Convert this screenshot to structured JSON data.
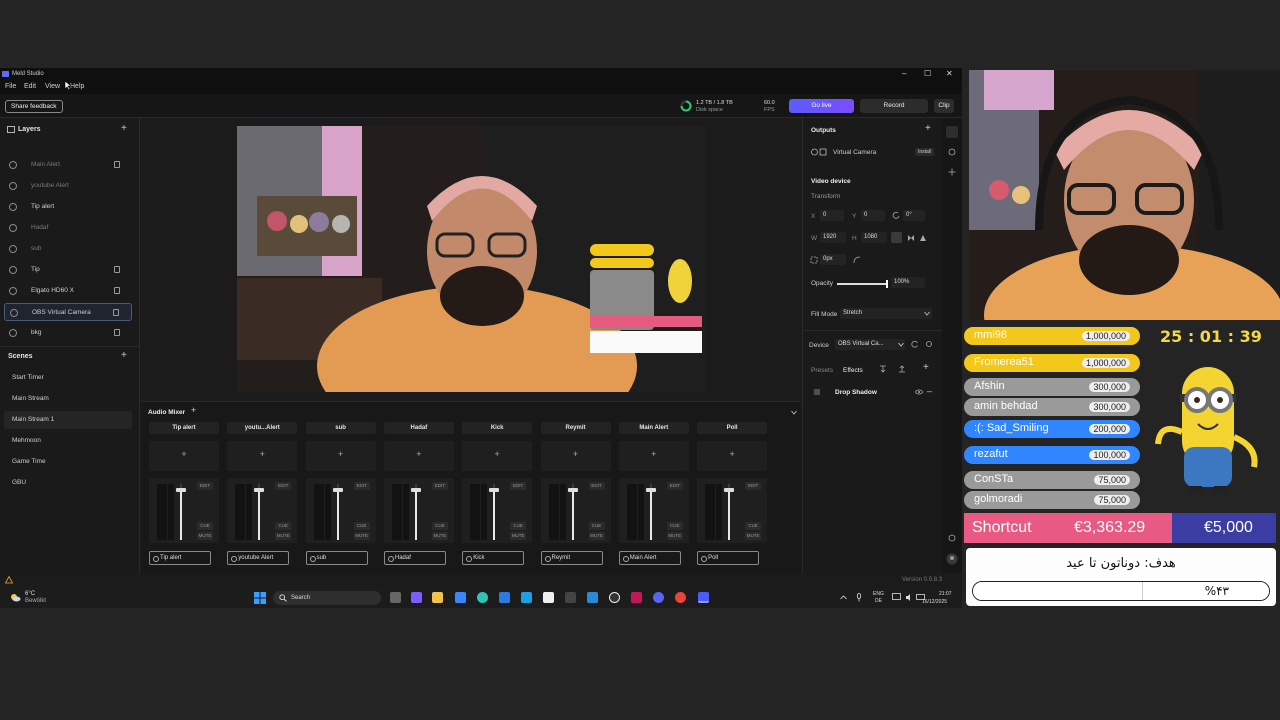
{
  "window": {
    "title": "Meld Studio",
    "minimize": "–",
    "maximize": "☐",
    "close": "✕"
  },
  "menu": [
    "File",
    "Edit",
    "View",
    "Help"
  ],
  "toolbar": {
    "share_feedback": "Share feedback",
    "disk": "1.2 TB / 1.8 TB",
    "disk_label": "Disk space",
    "fps": "60.0",
    "fps_label": "FPS",
    "go_live": "Go live",
    "record": "Record",
    "clip": "Clip"
  },
  "layers": {
    "title": "Layers",
    "items": [
      {
        "label": "Main Alert",
        "dim": true
      },
      {
        "label": "youtube Alert",
        "dim": true
      },
      {
        "label": "Tip alert",
        "dim": false
      },
      {
        "label": "Hadaf",
        "dim": true
      },
      {
        "label": "sub",
        "dim": true
      },
      {
        "label": "Tip",
        "dim": false
      },
      {
        "label": "Elgato HD60 X",
        "dim": false
      },
      {
        "label": "OBS Virtual Camera",
        "dim": false
      },
      {
        "label": "bkg",
        "dim": false
      }
    ]
  },
  "scenes": {
    "title": "Scenes",
    "items": [
      "Start Timer",
      "Main Stream",
      "Main Stream 1",
      "Mehmoon",
      "Game Time",
      "GBU"
    ]
  },
  "outputs": {
    "title": "Outputs",
    "virtual_camera": "Virtual Camera",
    "install": "Install"
  },
  "video_device": {
    "title": "Video device",
    "transform": "Transform",
    "x_label": "X",
    "x": "0",
    "y_label": "Y",
    "y": "0",
    "rotation": "0°",
    "w_label": "W",
    "w": "1920",
    "h_label": "H",
    "h": "1080",
    "corner": "0px",
    "opacity_label": "Opacity",
    "opacity": "100%",
    "opacity_value": 1.0,
    "fill_mode_label": "Fill Mode",
    "fill_mode": "Stretch",
    "device_label": "Device",
    "device": "OBS Virtual Ca...",
    "presets": "Presets",
    "effects": "Effects",
    "drop_shadow": "Drop Shadow"
  },
  "mixer": {
    "title": "Audio Mixer",
    "edit": "EDIT",
    "cue": "CUE",
    "mute": "MUTE",
    "channels": [
      {
        "head": "Tip alert",
        "foot": "Tip alert"
      },
      {
        "head": "youtu...Alert",
        "foot": "youtube Alert"
      },
      {
        "head": "sub",
        "foot": "sub"
      },
      {
        "head": "Hadaf",
        "foot": "Hadaf"
      },
      {
        "head": "Kick",
        "foot": "Kick"
      },
      {
        "head": "Reymit",
        "foot": "Reymit"
      },
      {
        "head": "Main Alert",
        "foot": "Main Alert"
      },
      {
        "head": "Poll",
        "foot": "Poll"
      }
    ]
  },
  "status": {
    "version": "Version 0.9.8.3"
  },
  "taskbar": {
    "weather_temp": "6°C",
    "weather_desc": "Bewölkt",
    "search": "Search",
    "lang1": "ENG",
    "lang2": "DE",
    "time": "21:07",
    "date": "16/12/2025"
  },
  "overlay": {
    "timer": "25 : 01 : 39",
    "donors": [
      {
        "name": "mmi98",
        "amount": "1,000,000",
        "color": "#f2c81b"
      },
      {
        "name": "Fromerea51",
        "amount": "1,000,000",
        "color": "#f2c81b"
      },
      {
        "name": "Afshin",
        "amount": "300,000",
        "color": "#9a9a9a"
      },
      {
        "name": "amin behdad",
        "amount": "300,000",
        "color": "#9a9a9a"
      },
      {
        "name": ":(: Sad_Smiling",
        "amount": "200,000",
        "color": "#2f86ff"
      },
      {
        "name": "rezafut",
        "amount": "100,000",
        "color": "#2f86ff"
      },
      {
        "name": "ConSTa",
        "amount": "75,000",
        "color": "#9a9a9a"
      },
      {
        "name": "golmoradi",
        "amount": "75,000",
        "color": "#9a9a9a"
      }
    ],
    "shortcut_label": "Shortcut",
    "shortcut_amount": "€3,363.29",
    "goal_amount": "€5,000",
    "goal_title": "هدف: دوناتون تا عید",
    "goal_percent": "%۴۳",
    "goal_progress": 0.43
  }
}
